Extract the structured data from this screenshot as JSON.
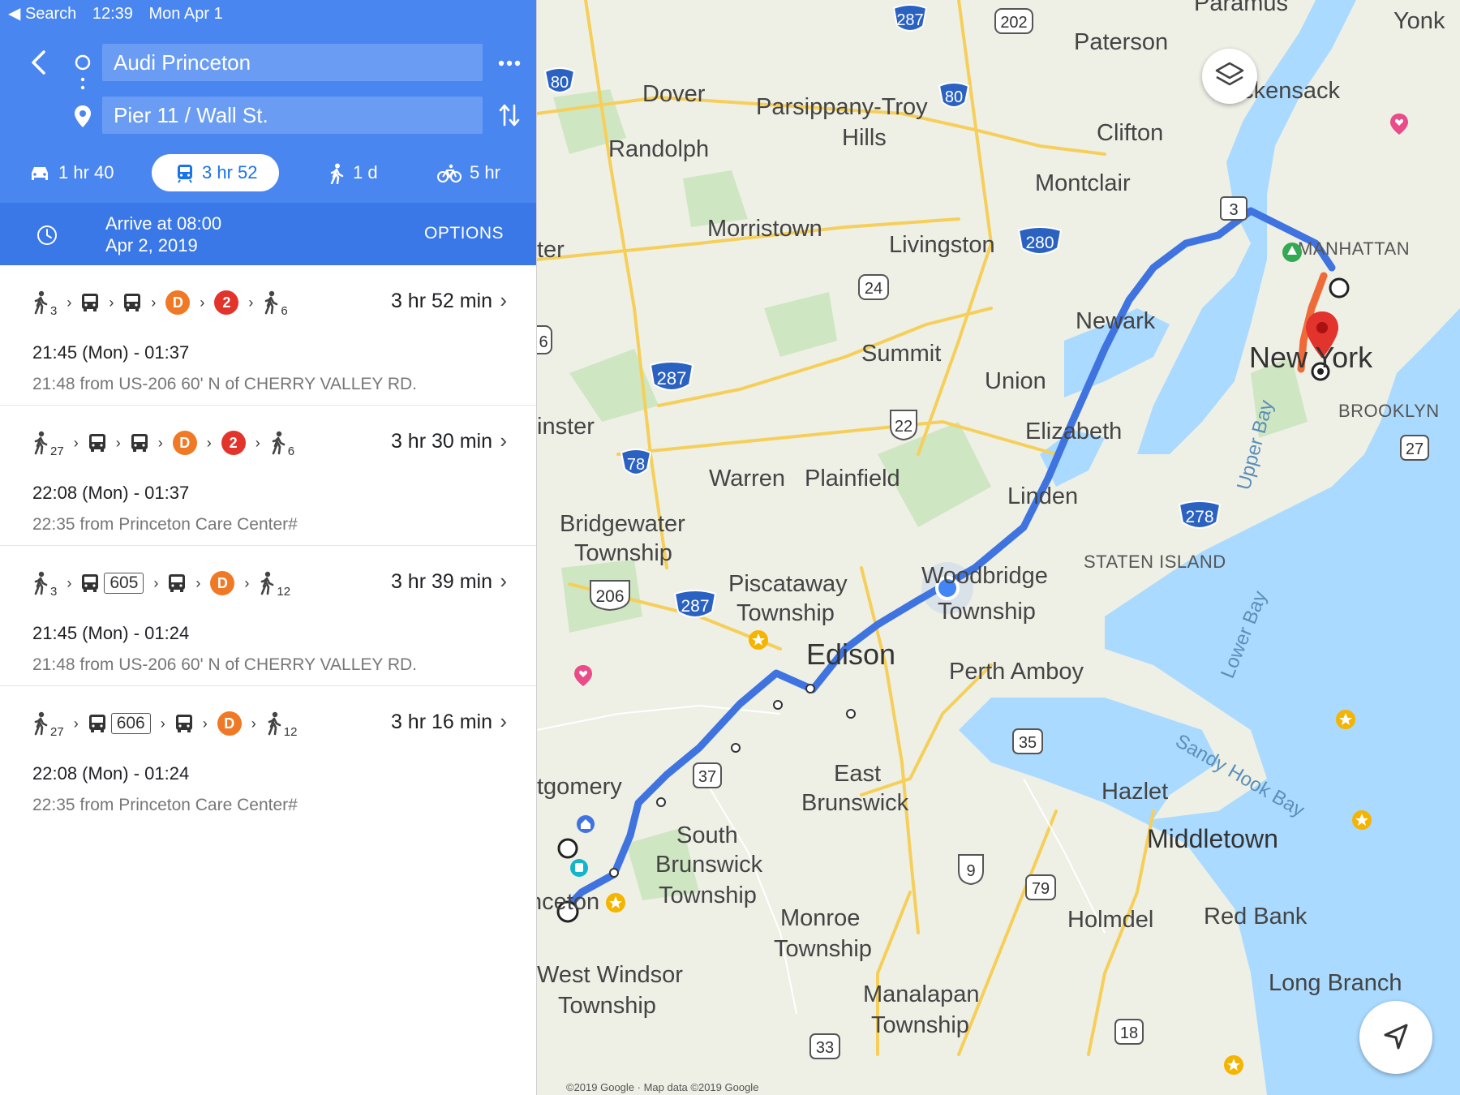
{
  "status_bar": {
    "back_label": "◀ Search",
    "time": "12:39",
    "date": "Mon Apr 1"
  },
  "directions": {
    "origin": "Audi Princeton",
    "destination": "Pier 11 / Wall St.",
    "modes": [
      {
        "name": "drive",
        "label": "1 hr 40"
      },
      {
        "name": "transit",
        "label": "3 hr 52",
        "selected": true
      },
      {
        "name": "walk",
        "label": "1 d"
      },
      {
        "name": "bike",
        "label": "5 hr"
      }
    ],
    "arrive_line1": "Arrive at 08:00",
    "arrive_line2": "Apr 2, 2019",
    "options_label": "OPTIONS"
  },
  "routes": [
    {
      "walk_start": "3",
      "bus1_num": "",
      "walk_end": "6",
      "lines": [
        "D",
        "2"
      ],
      "duration": "3 hr 52 min",
      "times": "21:45 (Mon) - 01:37",
      "from": "21:48 from US-206 60' N of CHERRY VALLEY RD."
    },
    {
      "walk_start": "27",
      "bus1_num": "",
      "walk_end": "6",
      "lines": [
        "D",
        "2"
      ],
      "duration": "3 hr 30 min",
      "times": "22:08 (Mon) - 01:37",
      "from": "22:35 from Princeton Care Center#"
    },
    {
      "walk_start": "3",
      "bus1_num": "605",
      "walk_end": "12",
      "lines": [
        "D"
      ],
      "duration": "3 hr 39 min",
      "times": "21:45 (Mon) - 01:24",
      "from": "21:48 from US-206 60' N of CHERRY VALLEY RD."
    },
    {
      "walk_start": "27",
      "bus1_num": "606",
      "walk_end": "12",
      "lines": [
        "D"
      ],
      "duration": "3 hr 16 min",
      "times": "22:08 (Mon) - 01:24",
      "from": "22:35 from Princeton Care Center#"
    }
  ],
  "map": {
    "places": [
      "Paramus",
      "Yonk",
      "Paterson",
      "Dover",
      "Hackensack",
      "Parsippany-Troy",
      "Hills",
      "Clifton",
      "Randolph",
      "Montclair",
      "Morristown",
      "Livingston",
      "MANHATTAN",
      "ter",
      "Newark",
      "Summit",
      "New York",
      "Union",
      "BROOKLYN",
      "inster",
      "Elizabeth",
      "Warren",
      "Plainfield",
      "Linden",
      "Upper Bay",
      "Bridgewater",
      "Township",
      "STATEN ISLAND",
      "Piscataway",
      "Township",
      "Woodbridge",
      "Township",
      "Lower Bay",
      "Edison",
      "Perth Amboy",
      "East",
      "Brunswick",
      "Sandy Hook Bay",
      "Hazlet",
      "tgomery",
      "South",
      "Brunswick",
      "Township",
      "Middletown",
      "Monroe",
      "Township",
      "Holmdel",
      "Red Bank",
      "nceton",
      "West Windsor",
      "Township",
      "Manalapan",
      "Township",
      "Long Branch"
    ],
    "shields": [
      "287",
      "202",
      "80",
      "80",
      "3",
      "280",
      "24",
      "6",
      "287",
      "22",
      "27",
      "78",
      "278",
      "206",
      "287",
      "35",
      "37",
      "9",
      "79",
      "18",
      "33"
    ],
    "copyright": "©2019 Google · Map data ©2019 Google"
  },
  "colors": {
    "header_blue": "#4a86f0",
    "arrive_blue": "#3b78e7",
    "route_blue": "#3f73e0",
    "subway_d": "#f07926",
    "subway_2": "#e3342b"
  }
}
